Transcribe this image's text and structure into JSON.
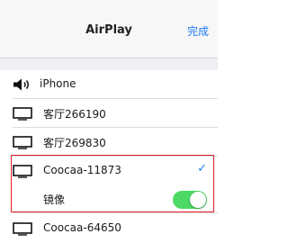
{
  "navbar": {
    "title": "AirPlay",
    "done_label": "完成"
  },
  "devices": [
    {
      "label": "iPhone",
      "icon": "speaker-icon"
    },
    {
      "label": "客厅266190",
      "icon": "tv-icon"
    },
    {
      "label": "客厅269830",
      "icon": "tv-icon"
    },
    {
      "label": "Coocaa-11873",
      "icon": "tv-icon",
      "selected": true
    },
    {
      "label": "Coocaa-64650",
      "icon": "tv-icon"
    }
  ],
  "mirroring": {
    "label": "镜像",
    "enabled": true
  },
  "colors": {
    "accent": "#1e7cf5",
    "toggle_on": "#4cd964",
    "highlight_border": "#e21e2a"
  }
}
